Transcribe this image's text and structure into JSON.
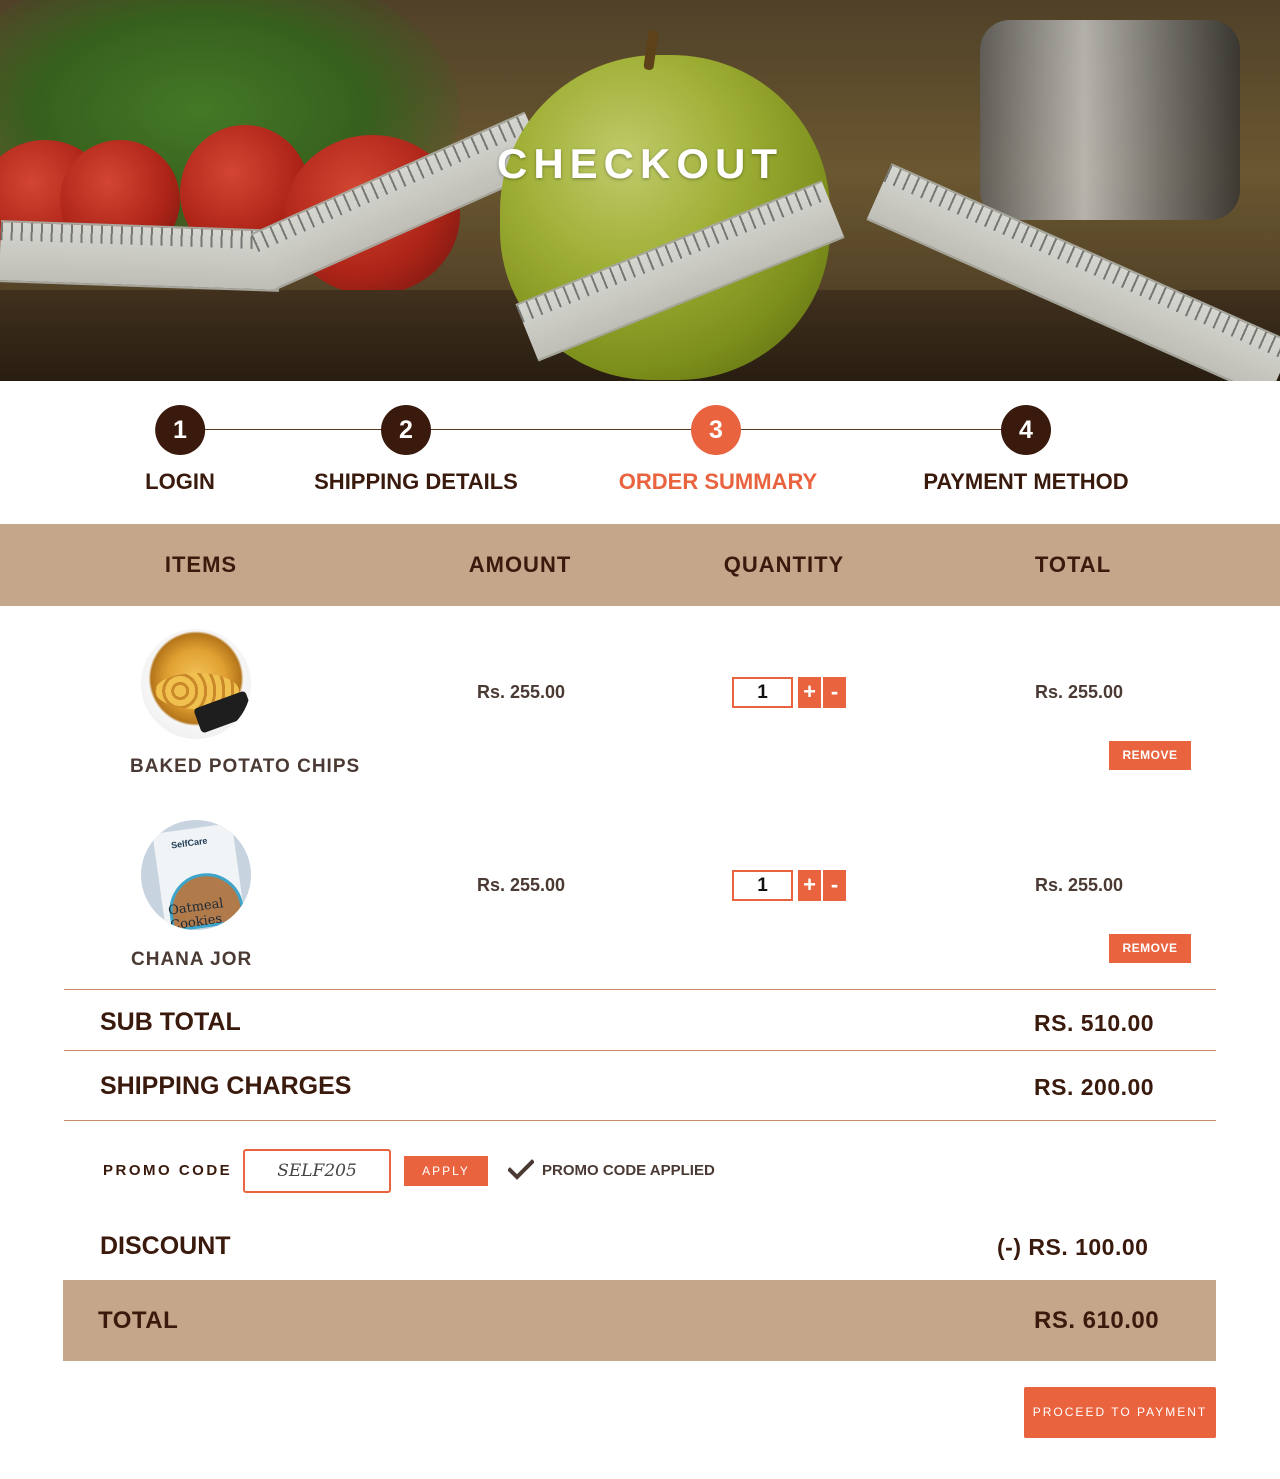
{
  "hero": {
    "title": "CHECKOUT"
  },
  "stepper": {
    "steps": [
      {
        "number": "1",
        "label": "LOGIN"
      },
      {
        "number": "2",
        "label": "SHIPPING DETAILS"
      },
      {
        "number": "3",
        "label": "ORDER SUMMARY"
      },
      {
        "number": "4",
        "label": "PAYMENT METHOD"
      }
    ],
    "active_step": "3"
  },
  "table": {
    "headers": {
      "items": "ITEMS",
      "amount": "AMOUNT",
      "quantity": "QUANTITY",
      "total": "TOTAL"
    },
    "rows": [
      {
        "name": "BAKED POTATO CHIPS",
        "amount": "Rs. 255.00",
        "quantity": "1",
        "plus": "+",
        "minus": "-",
        "total": "Rs. 255.00",
        "remove": "REMOVE"
      },
      {
        "name": "CHANA JOR",
        "amount": "Rs. 255.00",
        "quantity": "1",
        "plus": "+",
        "minus": "-",
        "total": "Rs. 255.00",
        "remove": "REMOVE",
        "thumb_brand": "SelfCare",
        "thumb_text": "Oatmeal Cookies"
      }
    ]
  },
  "summary": {
    "subtotal_label": "SUB TOTAL",
    "subtotal_value": "RS. 510.00",
    "shipping_label": "SHIPPING CHARGES",
    "shipping_value": "RS. 200.00",
    "promo_label": "PROMO CODE",
    "promo_value": "SELF205",
    "apply_label": "APPLY",
    "promo_status": "PROMO CODE APPLIED",
    "discount_label": "DISCOUNT",
    "discount_value": "(-) RS. 100.00",
    "total_label": "TOTAL",
    "total_value": "RS. 610.00"
  },
  "actions": {
    "proceed_label": "PROCEED TO PAYMENT"
  },
  "colors": {
    "accent": "#e9633f",
    "dark_brown": "#3a1a0c",
    "tan": "#c4a68a"
  }
}
